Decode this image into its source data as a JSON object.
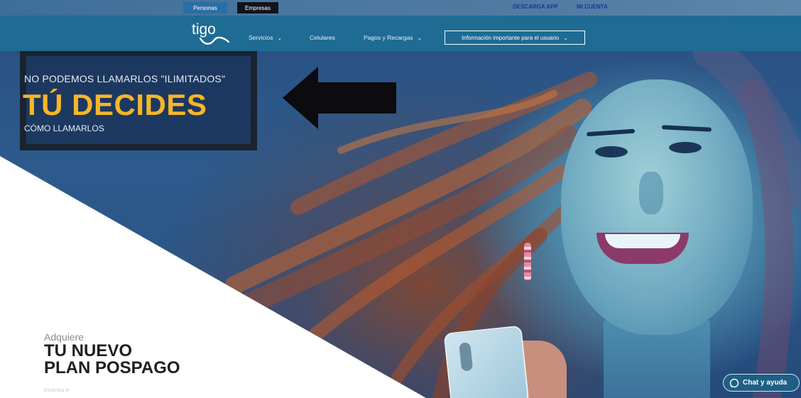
{
  "topbar": {
    "tabs": [
      {
        "label": "Personas",
        "active": true
      },
      {
        "label": "Empresas",
        "active": false
      }
    ],
    "links": [
      "DESCARGA APP",
      "MI CUENTA"
    ]
  },
  "navbar": {
    "logo": "tigo",
    "items": [
      {
        "label": "Servicios",
        "has_dropdown": true
      },
      {
        "label": "Celulares",
        "has_dropdown": false
      },
      {
        "label": "Pagos y Recargas",
        "has_dropdown": true
      }
    ],
    "info_button": {
      "label": "Información importante para el usuario",
      "has_dropdown": true
    }
  },
  "hero": {
    "promo": {
      "subtitle": "NO PODEMOS LLAMARLOS \"ILIMITADOS\"",
      "title": "TÚ DECIDES",
      "footer": "CÓMO LLAMARLOS"
    },
    "intro": "Adquiere",
    "headline_line1": "TU NUEVO",
    "headline_line2": "PLAN POSPAGO",
    "footnote": "Ecuentra el",
    "chat_button": {
      "label": "Chat y ayuda",
      "icon": "chat-bubble-icon"
    }
  },
  "colors": {
    "nav_bg": "#1e6b94",
    "accent_yellow": "#f7b627",
    "hero_bg": "#2a5384"
  }
}
